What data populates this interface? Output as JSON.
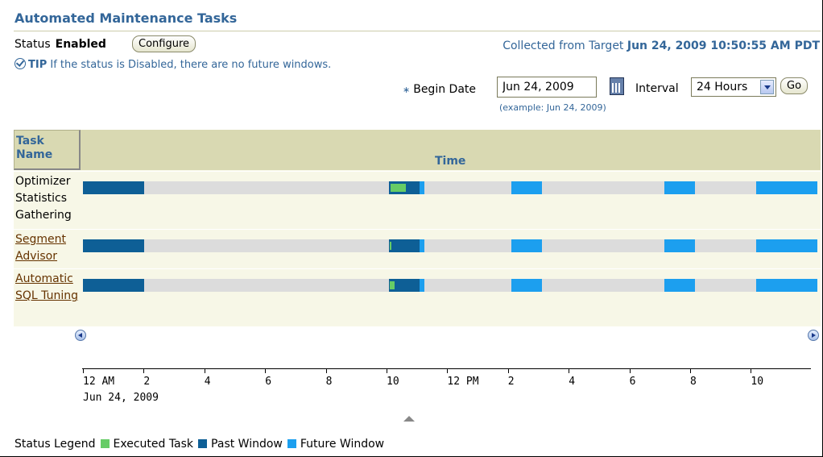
{
  "header": {
    "title": "Automated Maintenance Tasks",
    "status_label": "Status",
    "status_value": "Enabled",
    "configure_label": "Configure",
    "collected_prefix": "Collected from Target",
    "collected_value": "Jun 24, 2009 10:50:55 AM PDT",
    "tip_key": "TIP",
    "tip_text": "If the status is Disabled, there are no future windows."
  },
  "filter": {
    "required_mark": "∗",
    "begin_date_label": "Begin Date",
    "begin_date_value": "Jun 24, 2009",
    "example": "(example: Jun 24, 2009)",
    "interval_label": "Interval",
    "interval_value": "24 Hours",
    "go_label": "Go"
  },
  "table": {
    "col_task": "Task Name",
    "col_time": "Time",
    "rows": [
      {
        "name": "Optimizer Statistics Gathering",
        "link": false,
        "segments": [
          {
            "type": "past",
            "start": 0,
            "end": 2
          },
          {
            "type": "past",
            "start": 10,
            "end": 11
          },
          {
            "type": "executed",
            "start": 10.05,
            "end": 10.55
          },
          {
            "type": "future",
            "start": 11,
            "end": 11.15
          },
          {
            "type": "future",
            "start": 14,
            "end": 15
          },
          {
            "type": "future",
            "start": 19,
            "end": 20
          },
          {
            "type": "future",
            "start": 22,
            "end": 24
          }
        ]
      },
      {
        "name": "Segment Advisor",
        "link": true,
        "segments": [
          {
            "type": "past",
            "start": 0,
            "end": 2
          },
          {
            "type": "past",
            "start": 10,
            "end": 11
          },
          {
            "type": "executed",
            "start": 10.02,
            "end": 10.07
          },
          {
            "type": "future",
            "start": 11,
            "end": 11.15
          },
          {
            "type": "future",
            "start": 14,
            "end": 15
          },
          {
            "type": "future",
            "start": 19,
            "end": 20
          },
          {
            "type": "future",
            "start": 22,
            "end": 24
          }
        ]
      },
      {
        "name": "Automatic SQL Tuning",
        "link": true,
        "segments": [
          {
            "type": "past",
            "start": 0,
            "end": 2
          },
          {
            "type": "past",
            "start": 10,
            "end": 11
          },
          {
            "type": "executed",
            "start": 10.02,
            "end": 10.18
          },
          {
            "type": "future",
            "start": 11,
            "end": 11.15
          },
          {
            "type": "future",
            "start": 14,
            "end": 15
          },
          {
            "type": "future",
            "start": 19,
            "end": 20
          },
          {
            "type": "future",
            "start": 22,
            "end": 24
          }
        ]
      }
    ]
  },
  "axis": {
    "ticks": [
      {
        "hour": 0,
        "label": "12 AM"
      },
      {
        "hour": 2,
        "label": "2"
      },
      {
        "hour": 4,
        "label": "4"
      },
      {
        "hour": 6,
        "label": "6"
      },
      {
        "hour": 8,
        "label": "8"
      },
      {
        "hour": 10,
        "label": "10"
      },
      {
        "hour": 12,
        "label": "12 PM"
      },
      {
        "hour": 14,
        "label": "2"
      },
      {
        "hour": 16,
        "label": "4"
      },
      {
        "hour": 18,
        "label": "6"
      },
      {
        "hour": 20,
        "label": "8"
      },
      {
        "hour": 22,
        "label": "10"
      }
    ],
    "date": "Jun 24, 2009"
  },
  "legend": {
    "title": "Status Legend",
    "items": [
      {
        "label": "Executed Task",
        "color": "#66cc66"
      },
      {
        "label": "Past Window",
        "color": "#0e5f96"
      },
      {
        "label": "Future Window",
        "color": "#1c9fef"
      }
    ]
  },
  "colors": {
    "executed": "#66cc66",
    "past": "#0e5f96",
    "future": "#1c9fef"
  },
  "icons": [
    "tip-check-icon",
    "calendar-icon",
    "dropdown-arrow-icon",
    "scroll-left-icon",
    "scroll-right-icon",
    "splitter-icon"
  ]
}
